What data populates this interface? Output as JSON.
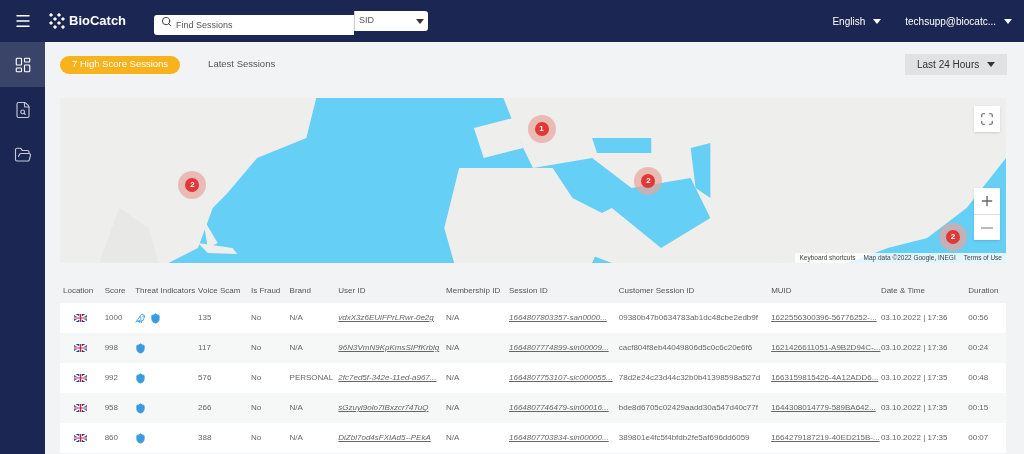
{
  "topbar": {
    "brand": "BioCatch",
    "search": {
      "placeholder": "Find Sessions"
    },
    "search_type": "SID",
    "language": "English",
    "user": "techsupp@biocatc..."
  },
  "sidebar": {
    "items": [
      {
        "kind": "dashboard",
        "selected": true
      },
      {
        "kind": "search",
        "selected": false
      },
      {
        "kind": "folder",
        "selected": false
      }
    ]
  },
  "tabs": [
    {
      "label": "7 High Score Sessions",
      "selected": true
    },
    {
      "label": "Latest Sessions",
      "selected": false
    }
  ],
  "time_range": "Last 24 Hours",
  "map": {
    "markers": [
      {
        "count": "2"
      },
      {
        "count": "1"
      },
      {
        "count": "2"
      },
      {
        "count": "2"
      }
    ],
    "attribution": [
      "Keyboard shortcuts",
      "Map data ©2022 Google, INEGI",
      "Terms of Use"
    ]
  },
  "table": {
    "columns": [
      "Location",
      "Score",
      "Threat Indicators",
      "Voice Scam",
      "Is Fraud",
      "Brand",
      "User ID",
      "Membership ID",
      "Session ID",
      "Customer Session ID",
      "MUID",
      "Date & Time",
      "Duration"
    ],
    "rows": [
      {
        "score": "1000",
        "threats": [
          {
            "kind": "bird"
          },
          {
            "kind": "shield"
          }
        ],
        "voice_scam": "135",
        "is_fraud": "No",
        "brand": "N/A",
        "user_id": "vdxX3z6EUiFPrLRwr-0e2g",
        "membership_id": "N/A",
        "session_id": "1664807803357-san0000...",
        "customer_session_id": "09380b47b0634783ab1dc48cbe2edb9f",
        "muid": "1622556300396-56776252-...",
        "date_time": "03.10.2022 | 17:36",
        "duration": "00:56"
      },
      {
        "score": "998",
        "threats": [
          {
            "kind": "shield"
          }
        ],
        "voice_scam": "117",
        "is_fraud": "No",
        "brand": "N/A",
        "user_id": "96N3VmN9KpKmsSIPfKrblg",
        "membership_id": "N/A",
        "session_id": "1664807774899-sin00009...",
        "customer_session_id": "cacf804f8eb44049806d5c0c6c20e6f6",
        "muid": "1621426611051-A9B2D94C-...",
        "date_time": "03.10.2022 | 17:36",
        "duration": "00:24"
      },
      {
        "score": "992",
        "threats": [
          {
            "kind": "shield"
          }
        ],
        "voice_scam": "576",
        "is_fraud": "No",
        "brand": "PERSONAL",
        "user_id": "2fc7ed5f-342e-11ed-a967...",
        "membership_id": "N/A",
        "session_id": "1664807753107-sic000055...",
        "customer_session_id": "78d2e24c23d44c32b0b41398598a527d",
        "muid": "1663159815426-4A12ADD6...",
        "date_time": "03.10.2022 | 17:35",
        "duration": "00:48"
      },
      {
        "score": "958",
        "threats": [
          {
            "kind": "shield"
          }
        ],
        "voice_scam": "266",
        "is_fraud": "No",
        "brand": "N/A",
        "user_id": "sGzuyi9olo7IBxzcr74TuQ",
        "membership_id": "N/A",
        "session_id": "1664807746479-sin00016...",
        "customer_session_id": "bde8d6705c02429aadd30a547d40c77f",
        "muid": "1644308014779-589BA642...",
        "date_time": "03.10.2022 | 17:35",
        "duration": "00:15"
      },
      {
        "score": "860",
        "threats": [
          {
            "kind": "shield"
          }
        ],
        "voice_scam": "388",
        "is_fraud": "No",
        "brand": "N/A",
        "user_id": "DiZbl7od4sFXIAd5--PEkA",
        "membership_id": "N/A",
        "session_id": "1664807703834-sin00000...",
        "customer_session_id": "389801e4fc5f4bfdb2fe5af696dd6059",
        "muid": "1664279187219-40ED215B-...",
        "date_time": "03.10.2022 | 17:35",
        "duration": "00:07"
      }
    ]
  }
}
